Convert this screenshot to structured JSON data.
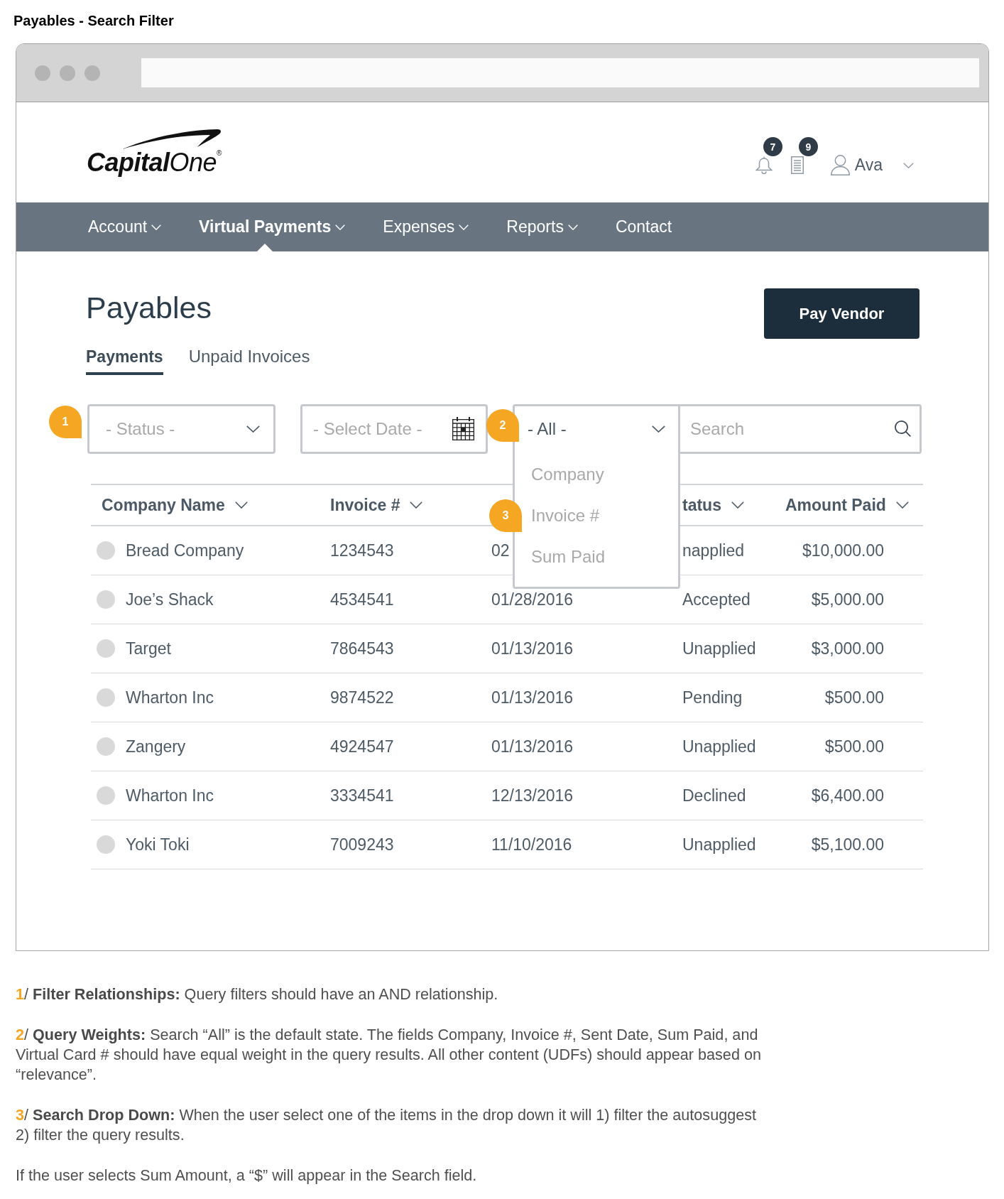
{
  "page_title": "Payables - Search Filter",
  "logo": {
    "bold": "Capital",
    "light": "One",
    "mark": "®"
  },
  "header": {
    "notifications": [
      {
        "kind": "bell",
        "count": "7"
      },
      {
        "kind": "document",
        "count": "9"
      }
    ],
    "user": {
      "name": "Ava"
    }
  },
  "nav": [
    {
      "label": "Account",
      "kind": "menu",
      "selected": false
    },
    {
      "label": "Virtual Payments",
      "kind": "menu",
      "selected": true
    },
    {
      "label": "Expenses",
      "kind": "menu",
      "selected": false
    },
    {
      "label": "Reports",
      "kind": "menu",
      "selected": false
    },
    {
      "label": "Contact",
      "kind": "link",
      "selected": false
    }
  ],
  "page": {
    "heading": "Payables",
    "primary_button": "Pay Vendor"
  },
  "tabs": [
    {
      "label": "Payments",
      "selected": true
    },
    {
      "label": "Unpaid Invoices",
      "selected": false
    }
  ],
  "filters": {
    "status": {
      "placeholder": "- Status -",
      "marker": "1"
    },
    "date": {
      "placeholder": "- Select Date -"
    },
    "scope": {
      "value": "- All -",
      "expanded": true,
      "marker": "2",
      "options": [
        {
          "label": "Company",
          "selected": false
        },
        {
          "label": "Invoice #",
          "selected": false,
          "marker": "3"
        },
        {
          "label": "Sum Paid",
          "selected": false
        }
      ]
    },
    "search": {
      "placeholder": "Search"
    }
  },
  "table": {
    "header": {
      "company_name": "Company Name",
      "invoice": "Invoice #",
      "status": "tatus",
      "amount_paid": "Amount Paid"
    },
    "rows": [
      {
        "selected": false,
        "company_name": "Bread Company",
        "invoice": "1234543",
        "column_3": "02",
        "status": "napplied",
        "amount_paid": "$10,000.00"
      },
      {
        "selected": false,
        "company_name": "Joe’s Shack",
        "invoice": "4534541",
        "column_3": "01/28/2016",
        "status": "Accepted",
        "amount_paid": "$5,000.00"
      },
      {
        "selected": false,
        "company_name": "Target",
        "invoice": "7864543",
        "column_3": "01/13/2016",
        "status": "Unapplied",
        "amount_paid": "$3,000.00"
      },
      {
        "selected": false,
        "company_name": "Wharton Inc",
        "invoice": "9874522",
        "column_3": "01/13/2016",
        "status": "Pending",
        "amount_paid": "$500.00"
      },
      {
        "selected": false,
        "company_name": "Zangery",
        "invoice": "4924547",
        "column_3": "01/13/2016",
        "status": "Unapplied",
        "amount_paid": "$500.00"
      },
      {
        "selected": false,
        "company_name": "Wharton Inc",
        "invoice": "3334541",
        "column_3": "12/13/2016",
        "status": "Declined",
        "amount_paid": "$6,400.00"
      },
      {
        "selected": false,
        "company_name": "Yoki Toki",
        "invoice": "7009243",
        "column_3": "11/10/2016",
        "status": "Unapplied",
        "amount_paid": "$5,100.00"
      }
    ]
  },
  "notes": [
    {
      "number": "1",
      "separator": "/",
      "title": "Filter Relationships:",
      "text": "Query filters should have an AND relationship."
    },
    {
      "number": "2",
      "separator": "/",
      "title": "Query Weights:",
      "text": "Search “All” is the default state. The fields Company, Invoice #, Sent Date, Sum Paid, and Virtual Card # should have equal weight in the query results. All other content (UDFs) should appear based on “relevance”."
    },
    {
      "number": "3",
      "separator": "/",
      "title": "Search Drop Down:",
      "text": "When the user select one of the items in the drop down it will 1) filter the autosuggest 2) filter the query results."
    },
    {
      "text": "If the user selects Sum Amount, a “$” will appear in the Search field."
    }
  ]
}
